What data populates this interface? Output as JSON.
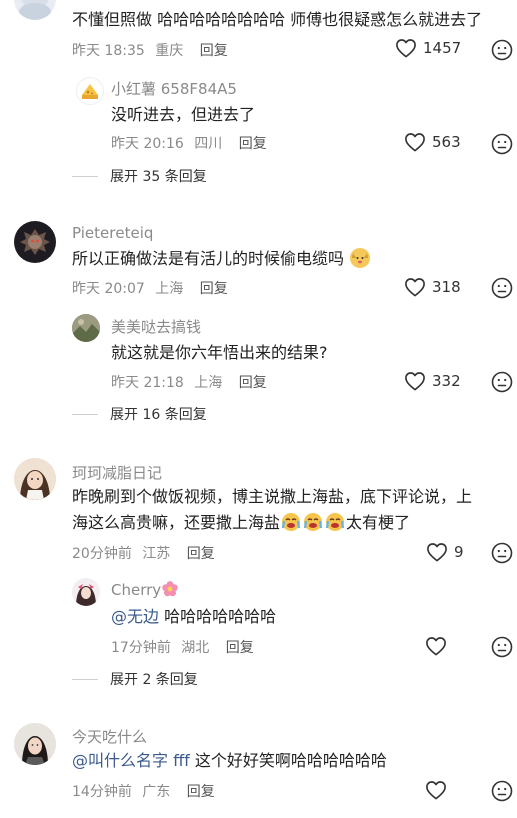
{
  "comments": [
    {
      "text": "不懂但照做 哈哈哈哈哈哈哈哈 师傅也很疑惑怎么就进去了",
      "time": "昨天 18:35",
      "location": "重庆",
      "reply_label": "回复",
      "likes": "1457",
      "replies": [
        {
          "user": "小红薯 658F84A5",
          "text": "没听进去，但进去了",
          "time": "昨天 20:16",
          "location": "四川",
          "reply_label": "回复",
          "likes": "563"
        }
      ],
      "expand_label": "展开 35 条回复"
    },
    {
      "user": "Pieterеteiq",
      "text": "所以正确做法是有活儿的时候偷电缆吗",
      "time": "昨天 20:07",
      "location": "上海",
      "reply_label": "回复",
      "likes": "318",
      "replies": [
        {
          "user": "美美哒去搞钱",
          "text": "就这就是你六年悟出来的结果?",
          "time": "昨天 21:18",
          "location": "上海",
          "reply_label": "回复",
          "likes": "332"
        }
      ],
      "expand_label": "展开 16 条回复"
    },
    {
      "user": "珂珂减脂日记",
      "text_line1": "昨晚刷到个做饭视频，博主说撒上海盐，底下评论说，上",
      "text_line2a": "海这么高贵嘛，还要撒上海盐",
      "text_line2b": "太有梗了",
      "time": "20分钟前",
      "location": "江苏",
      "reply_label": "回复",
      "likes": "9",
      "replies": [
        {
          "user": "Cherry",
          "mention": "@无边",
          "text": "哈哈哈哈哈哈哈",
          "time": "17分钟前",
          "location": "湖北",
          "reply_label": "回复",
          "likes": ""
        }
      ],
      "expand_label": "展开 2 条回复"
    },
    {
      "user": "今天吃什么",
      "mention": "@叫什么名字 fff",
      "text": "这个好好笑啊哈哈哈哈哈哈",
      "time": "14分钟前",
      "location": "广东",
      "reply_label": "回复",
      "likes": ""
    }
  ],
  "icons": {
    "like": "heart-outline-icon",
    "dislike": "unhappy-face-icon"
  },
  "colors": {
    "meta": "#8a8a8a",
    "mention": "#3a5a8c",
    "text": "#222222"
  }
}
